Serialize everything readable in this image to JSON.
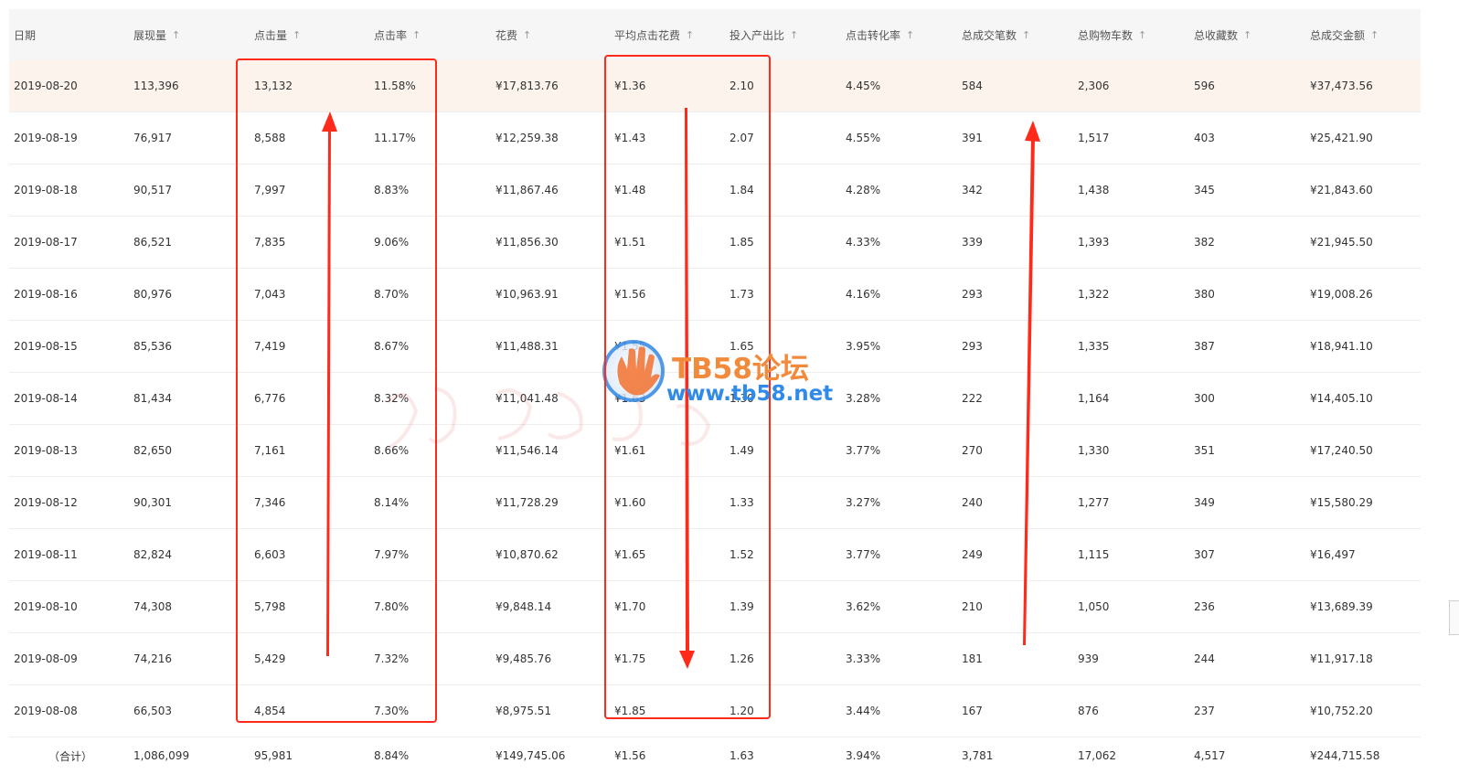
{
  "table": {
    "headers": [
      "日期",
      "展现量",
      "点击量",
      "点击率",
      "花费",
      "平均点击花费",
      "投入产出比",
      "点击转化率",
      "总成交笔数",
      "总购物车数",
      "总收藏数",
      "总成交金额"
    ],
    "sort_arrow": "↑",
    "rows": [
      [
        "2019-08-20",
        "113,396",
        "13,132",
        "11.58%",
        "¥17,813.76",
        "¥1.36",
        "2.10",
        "4.45%",
        "584",
        "2,306",
        "596",
        "¥37,473.56"
      ],
      [
        "2019-08-19",
        "76,917",
        "8,588",
        "11.17%",
        "¥12,259.38",
        "¥1.43",
        "2.07",
        "4.55%",
        "391",
        "1,517",
        "403",
        "¥25,421.90"
      ],
      [
        "2019-08-18",
        "90,517",
        "7,997",
        "8.83%",
        "¥11,867.46",
        "¥1.48",
        "1.84",
        "4.28%",
        "342",
        "1,438",
        "345",
        "¥21,843.60"
      ],
      [
        "2019-08-17",
        "86,521",
        "7,835",
        "9.06%",
        "¥11,856.30",
        "¥1.51",
        "1.85",
        "4.33%",
        "339",
        "1,393",
        "382",
        "¥21,945.50"
      ],
      [
        "2019-08-16",
        "80,976",
        "7,043",
        "8.70%",
        "¥10,963.91",
        "¥1.56",
        "1.73",
        "4.16%",
        "293",
        "1,322",
        "380",
        "¥19,008.26"
      ],
      [
        "2019-08-15",
        "85,536",
        "7,419",
        "8.67%",
        "¥11,488.31",
        "¥1.55",
        "1.65",
        "3.95%",
        "293",
        "1,335",
        "387",
        "¥18,941.10"
      ],
      [
        "2019-08-14",
        "81,434",
        "6,776",
        "8.32%",
        "¥11,041.48",
        "¥1.63",
        "1.30",
        "3.28%",
        "222",
        "1,164",
        "300",
        "¥14,405.10"
      ],
      [
        "2019-08-13",
        "82,650",
        "7,161",
        "8.66%",
        "¥11,546.14",
        "¥1.61",
        "1.49",
        "3.77%",
        "270",
        "1,330",
        "351",
        "¥17,240.50"
      ],
      [
        "2019-08-12",
        "90,301",
        "7,346",
        "8.14%",
        "¥11,728.29",
        "¥1.60",
        "1.33",
        "3.27%",
        "240",
        "1,277",
        "349",
        "¥15,580.29"
      ],
      [
        "2019-08-11",
        "82,824",
        "6,603",
        "7.97%",
        "¥10,870.62",
        "¥1.65",
        "1.52",
        "3.77%",
        "249",
        "1,115",
        "307",
        "¥16,497"
      ],
      [
        "2019-08-10",
        "74,308",
        "5,798",
        "7.80%",
        "¥9,848.14",
        "¥1.70",
        "1.39",
        "3.62%",
        "210",
        "1,050",
        "236",
        "¥13,689.39"
      ],
      [
        "2019-08-09",
        "74,216",
        "5,429",
        "7.32%",
        "¥9,485.76",
        "¥1.75",
        "1.26",
        "3.33%",
        "181",
        "939",
        "244",
        "¥11,917.18"
      ],
      [
        "2019-08-08",
        "66,503",
        "4,854",
        "7.30%",
        "¥8,975.51",
        "¥1.85",
        "1.20",
        "3.44%",
        "167",
        "876",
        "237",
        "¥10,752.20"
      ]
    ],
    "total": [
      "（合计）",
      "1,086,099",
      "95,981",
      "8.84%",
      "¥149,745.06",
      "¥1.56",
      "1.63",
      "3.94%",
      "3,781",
      "17,062",
      "4,517",
      "¥244,715.58"
    ]
  },
  "watermark": {
    "brand": "TB58论坛",
    "url": "www.tb58.net"
  },
  "colors": {
    "highlight_row": "#fbf3ec",
    "header_bg": "#f6f6f6",
    "annotation_red": "#ff2a1a"
  }
}
